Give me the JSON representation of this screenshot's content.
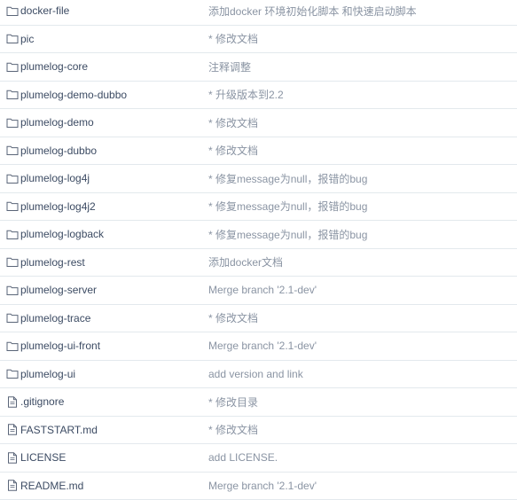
{
  "rows": [
    {
      "type": "folder",
      "name": "docker-file",
      "commit": "添加docker 环境初始化脚本 和快速启动脚本"
    },
    {
      "type": "folder",
      "name": "pic",
      "commit": "* 修改文档"
    },
    {
      "type": "folder",
      "name": "plumelog-core",
      "commit": "注释调整"
    },
    {
      "type": "folder",
      "name": "plumelog-demo-dubbo",
      "commit": "* 升级版本到2.2"
    },
    {
      "type": "folder",
      "name": "plumelog-demo",
      "commit": "* 修改文档"
    },
    {
      "type": "folder",
      "name": "plumelog-dubbo",
      "commit": "* 修改文档"
    },
    {
      "type": "folder",
      "name": "plumelog-log4j",
      "commit": "* 修复message为null，报错的bug"
    },
    {
      "type": "folder",
      "name": "plumelog-log4j2",
      "commit": "* 修复message为null，报错的bug"
    },
    {
      "type": "folder",
      "name": "plumelog-logback",
      "commit": "* 修复message为null，报错的bug"
    },
    {
      "type": "folder",
      "name": "plumelog-rest",
      "commit": "添加docker文档"
    },
    {
      "type": "folder",
      "name": "plumelog-server",
      "commit": "Merge branch '2.1-dev'"
    },
    {
      "type": "folder",
      "name": "plumelog-trace",
      "commit": "* 修改文档"
    },
    {
      "type": "folder",
      "name": "plumelog-ui-front",
      "commit": "Merge branch '2.1-dev'"
    },
    {
      "type": "folder",
      "name": "plumelog-ui",
      "commit": "add version and link"
    },
    {
      "type": "file",
      "name": ".gitignore",
      "commit": "* 修改目录"
    },
    {
      "type": "file",
      "name": "FASTSTART.md",
      "commit": "* 修改文档"
    },
    {
      "type": "file",
      "name": "LICENSE",
      "commit": "add LICENSE."
    },
    {
      "type": "file",
      "name": "README.md",
      "commit": "Merge branch '2.1-dev'"
    }
  ],
  "icons": {
    "folder": "folder-icon",
    "file": "file-icon"
  },
  "colors": {
    "name_text": "#3c4b63",
    "commit_text": "#8a94a3",
    "divider": "#e3e9ed",
    "icon_stroke": "#5a6578"
  }
}
